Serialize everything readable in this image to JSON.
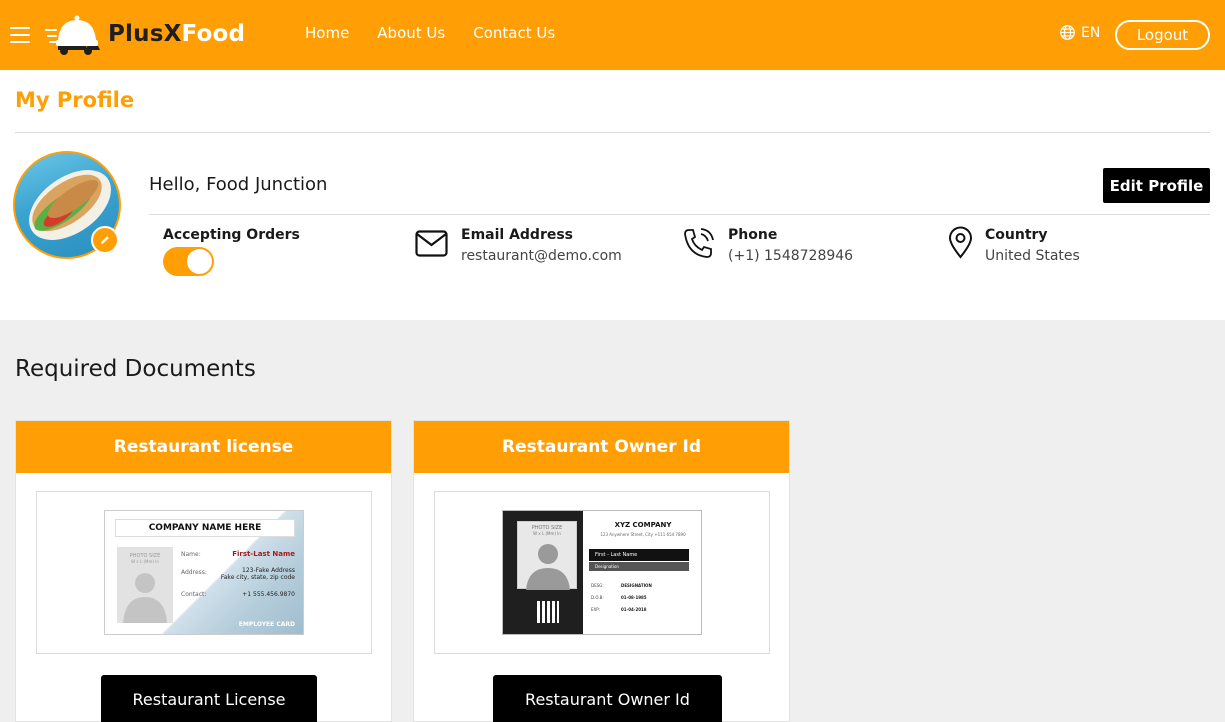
{
  "header": {
    "logo_part1": "PlusX",
    "logo_part2": "Food",
    "nav": [
      "Home",
      "About Us",
      "Contact Us"
    ],
    "language": "EN",
    "logout_label": "Logout"
  },
  "profile": {
    "title": "My Profile",
    "greeting": "Hello, Food Junction",
    "edit_label": "Edit Profile",
    "accepting_orders_label": "Accepting Orders",
    "accepting_orders": true,
    "email_label": "Email Address",
    "email_value": "restaurant@demo.com",
    "phone_label": "Phone",
    "phone_value": "(+1) 1548728946",
    "country_label": "Country",
    "country_value": "United States"
  },
  "documents": {
    "title": "Required Documents",
    "cards": [
      {
        "heading": "Restaurant license",
        "button": "Restaurant License",
        "preview": {
          "company": "COMPANY NAME HERE",
          "photo_note": "PHOTO SIZE",
          "photo_note2": "W x L (Mm) In",
          "name_label": "Name:",
          "name_value": "First-Last Name",
          "address_label": "Address:",
          "address_line1": "123-Fake Address",
          "address_line2": "Fake city, state, zip code",
          "contact_label": "Contact:",
          "contact_value": "+1 555.456.9870",
          "footer": "EMPLOYEE CARD"
        }
      },
      {
        "heading": "Restaurant Owner Id",
        "button": "Restaurant Owner Id",
        "preview": {
          "photo_note": "PHOTO SIZE",
          "photo_note2": "W x L (Mm) In",
          "company": "XYZ COMPANY",
          "address": "123 Anywhere Street, City +111 654 7890",
          "name": "First - Last Name",
          "designation_bar": "Designation",
          "desig_label": "DESG:",
          "desig_value": "DESIGNATION",
          "dob_label": "D.O.B:",
          "dob_value": "01-08-1985",
          "exp_label": "EXP:",
          "exp_value": "01-04-2018"
        }
      }
    ]
  },
  "colors": {
    "brand": "#ff9f05",
    "dark": "#000000",
    "section_bg": "#efefef"
  }
}
